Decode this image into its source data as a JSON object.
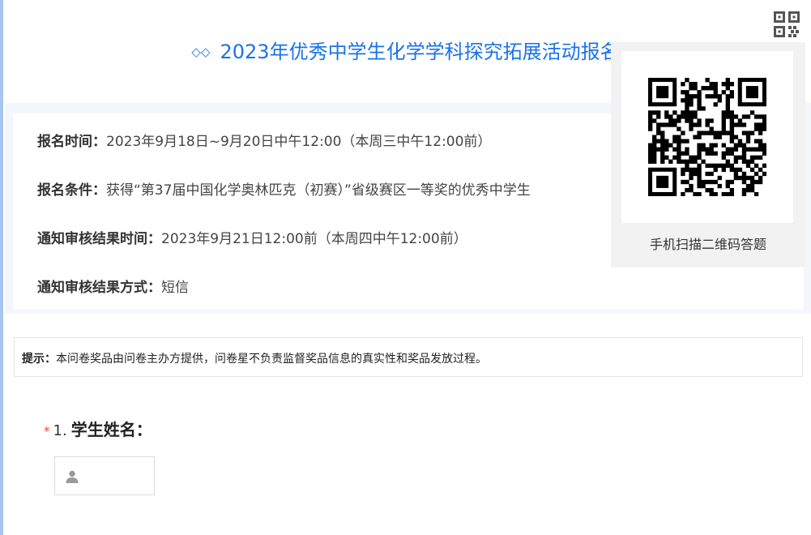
{
  "survey": {
    "title": "2023年优秀中学生化学学科探究拓展活动报名",
    "title_color": "#1a73e8"
  },
  "info": {
    "registration_time_label": "报名时间：",
    "registration_time_value": "2023年9月18日~9月20日中午12:00（本周三中午12:00前）",
    "registration_condition_label": "报名条件：",
    "registration_condition_value": "获得“第37届中国化学奥林匹克（初赛）”省级赛区一等奖的优秀中学生",
    "notify_time_label": "通知审核结果时间：",
    "notify_time_value": "2023年9月21日12:00前（本周四中午12:00前）",
    "notify_method_label": "通知审核结果方式：",
    "notify_method_value": "短信"
  },
  "tip": {
    "label": "提示：",
    "text": "本问卷奖品由问卷主办方提供，问卷星不负责监督奖品信息的真实性和奖品发放过程。"
  },
  "question": {
    "required_mark": "*",
    "number": "1.",
    "title": "学生姓名：",
    "input_value": ""
  },
  "qr": {
    "caption": "手机扫描二维码答题",
    "toggle_icon": "qr-code-icon"
  },
  "colors": {
    "accent": "#1a73e8",
    "required": "#e84242",
    "panel_bg": "#f3f6fb"
  }
}
